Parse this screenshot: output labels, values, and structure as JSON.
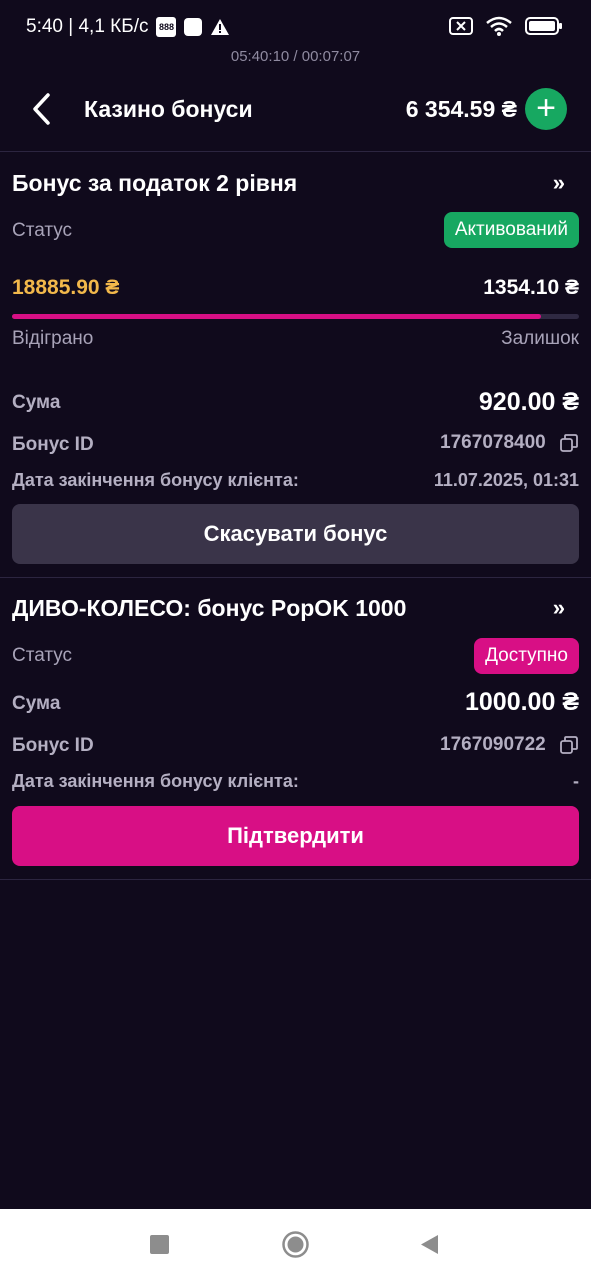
{
  "status_bar": {
    "time": "5:40 | 4,1 КБ/с",
    "app_badge": "888",
    "timer": "05:40:10 / 00:07:07"
  },
  "header": {
    "title": "Казино бонуси",
    "balance": "6 354.59 ₴",
    "add_label": "+"
  },
  "bonus1": {
    "title": "Бонус за податок 2 рівня",
    "status_label": "Статус",
    "status_value": "Активований",
    "wagered": "18885.90 ₴",
    "remaining": "1354.10 ₴",
    "progress_fraction": 0.933,
    "wagered_label": "Відіграно",
    "remaining_label": "Залишок",
    "sum_label": "Сума",
    "sum_value": "920.00 ₴",
    "id_label": "Бонус ID",
    "id_value": "1767078400",
    "expiry_label": "Дата закінчення бонусу клієнта:",
    "expiry_value": "11.07.2025, 01:31",
    "button_label": "Скасувати бонус"
  },
  "bonus2": {
    "title": "ДИВО-КОЛЕСО: бонус PopOK 1000",
    "status_label": "Статус",
    "status_value": "Доступно",
    "sum_label": "Сума",
    "sum_value": "1000.00 ₴",
    "id_label": "Бонус ID",
    "id_value": "1767090722",
    "expiry_label": "Дата закінчення бонусу клієнта:",
    "expiry_value": "-",
    "button_label": "Підтвердити"
  },
  "colors": {
    "background": "#100a1c",
    "accent_pink": "#d80f85",
    "accent_green": "#17a861",
    "gold": "#f2b84b"
  },
  "icons": {
    "back": "chevron-left-icon",
    "expand": "double-chevron-right-icon",
    "copy": "copy-icon",
    "nav_recent": "square-icon",
    "nav_home": "circle-icon",
    "nav_back": "triangle-back-icon"
  }
}
